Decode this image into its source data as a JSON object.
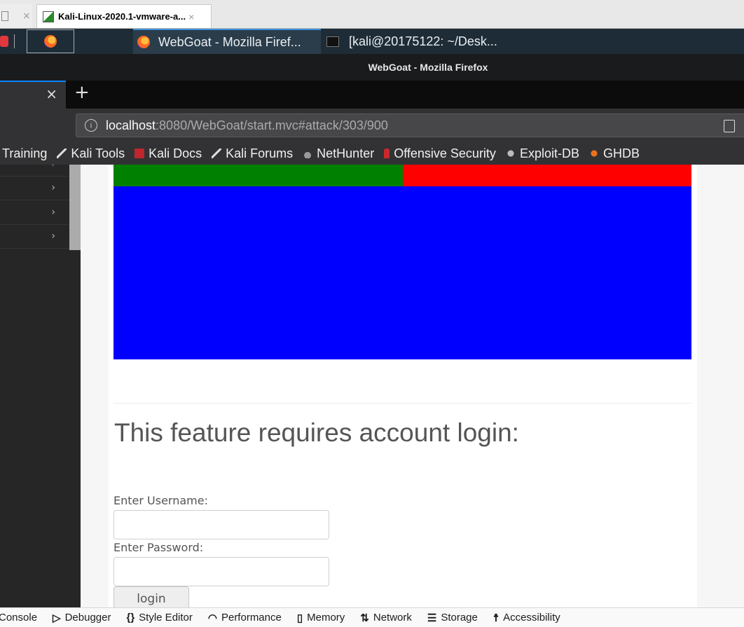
{
  "vm_tabs": [
    {
      "label": "",
      "close": "×"
    },
    {
      "label": "Kali-Linux-2020.1-vmware-a...",
      "close": "×"
    }
  ],
  "panel": {
    "tasks": [
      {
        "label": "WebGoat - Mozilla Firef..."
      },
      {
        "label": "[kali@20175122: ~/Desk..."
      }
    ]
  },
  "window": {
    "title": "WebGoat - Mozilla Firefox"
  },
  "browser": {
    "tab_close": "×",
    "new_tab": "+",
    "url_host": "localhost",
    "url_rest": ":8080/WebGoat/start.mvc#attack/303/900",
    "bookmarks": [
      "Training",
      "Kali Tools",
      "Kali Docs",
      "Kali Forums",
      "NetHunter",
      "Offensive Security",
      "Exploit-DB",
      "GHDB"
    ]
  },
  "sidebar": {
    "chevron": "›"
  },
  "page": {
    "colors": {
      "green": "#008000",
      "red": "#ff0000",
      "blue": "#0000ff"
    },
    "login_title": "This feature requires account login:",
    "username_label": "Enter Username:",
    "password_label": "Enter Password:",
    "login_button": "login"
  },
  "devtools": {
    "tabs": [
      "Console",
      "Debugger",
      "Style Editor",
      "Performance",
      "Memory",
      "Network",
      "Storage",
      "Accessibility"
    ]
  }
}
